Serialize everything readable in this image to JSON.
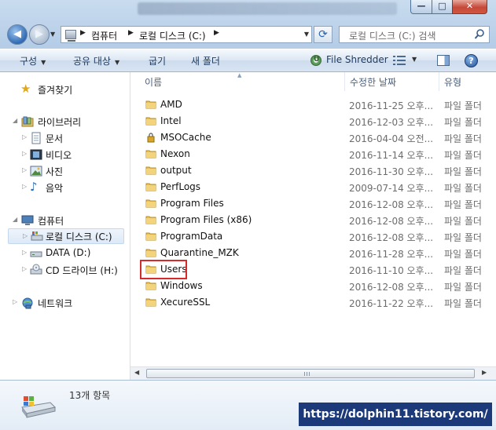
{
  "window": {
    "minimize_glyph": "—",
    "maximize_glyph": "□",
    "close_glyph": "✕"
  },
  "address_bar": {
    "crumbs": [
      "컴퓨터",
      "로컬 디스크 (C:)"
    ]
  },
  "search": {
    "placeholder": "로컬 디스크 (C:) 검색"
  },
  "command_bar": {
    "organize": "구성",
    "share_with": "공유 대상",
    "burn": "굽기",
    "new_folder": "새 폴더",
    "file_shredder": "File Shredder"
  },
  "nav_pane": {
    "favorites": "즐겨찾기",
    "libraries": "라이브러리",
    "library_items": [
      "문서",
      "비디오",
      "사진",
      "음악"
    ],
    "computer": "컴퓨터",
    "drives": [
      "로컬 디스크 (C:)",
      "DATA (D:)",
      "CD 드라이브 (H:)"
    ],
    "network": "네트워크"
  },
  "columns": {
    "name": "이름",
    "modified": "수정한 날짜",
    "type": "유형"
  },
  "files": [
    {
      "name": "AMD",
      "date": "2016-11-25 오후...",
      "type": "파일 폴더",
      "locked": false
    },
    {
      "name": "Intel",
      "date": "2016-12-03 오후...",
      "type": "파일 폴더",
      "locked": false
    },
    {
      "name": "MSOCache",
      "date": "2016-04-04 오전...",
      "type": "파일 폴더",
      "locked": true
    },
    {
      "name": "Nexon",
      "date": "2016-11-14 오후...",
      "type": "파일 폴더",
      "locked": false
    },
    {
      "name": "output",
      "date": "2016-11-30 오후...",
      "type": "파일 폴더",
      "locked": false
    },
    {
      "name": "PerfLogs",
      "date": "2009-07-14 오후...",
      "type": "파일 폴더",
      "locked": false
    },
    {
      "name": "Program Files",
      "date": "2016-12-08 오후...",
      "type": "파일 폴더",
      "locked": false
    },
    {
      "name": "Program Files (x86)",
      "date": "2016-12-08 오후...",
      "type": "파일 폴더",
      "locked": false
    },
    {
      "name": "ProgramData",
      "date": "2016-12-08 오후...",
      "type": "파일 폴더",
      "locked": false
    },
    {
      "name": "Quarantine_MZK",
      "date": "2016-11-28 오후...",
      "type": "파일 폴더",
      "locked": false
    },
    {
      "name": "Users",
      "date": "2016-11-10 오후...",
      "type": "파일 폴더",
      "locked": false,
      "highlighted": true
    },
    {
      "name": "Windows",
      "date": "2016-12-08 오후...",
      "type": "파일 폴더",
      "locked": false
    },
    {
      "name": "XecureSSL",
      "date": "2016-11-22 오후...",
      "type": "파일 폴더",
      "locked": false
    }
  ],
  "status": {
    "item_count": "13개 항목"
  },
  "watermark": "https://dolphin11.tistory.com/",
  "colors": {
    "folder": "#e9c25a",
    "highlight": "#d72a2a",
    "watermark_bg": "#1c3a7a"
  }
}
